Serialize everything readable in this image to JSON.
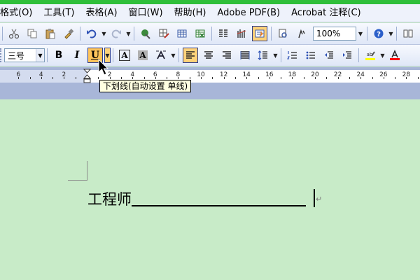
{
  "menu": [
    "格式(O)",
    "工具(T)",
    "表格(A)",
    "窗口(W)",
    "帮助(H)",
    "Adobe PDF(B)",
    "Acrobat 注释(C)"
  ],
  "toolbar1": {
    "zoom": "100%"
  },
  "toolbar2": {
    "font_size": "三号",
    "bold_label": "B",
    "italic_label": "I",
    "underline_label": "U",
    "char_border_label": "A",
    "char_shading_label": "A"
  },
  "ruler": {
    "left_ticks": [
      "6",
      "4",
      "2"
    ],
    "right_ticks": [
      "2",
      "4",
      "6",
      "8",
      "10",
      "12",
      "14",
      "16",
      "18",
      "20",
      "22",
      "24",
      "26",
      "28"
    ]
  },
  "tooltip": "下划线(自动设置 单线)",
  "document": {
    "text": "工程师"
  },
  "colors": {
    "document_bg": "#c8ebc8",
    "highlight": "#ffff00",
    "font_color": "#ff0000",
    "active_button": "#ffd27a"
  },
  "icons": [
    "cut-icon",
    "copy-icon",
    "paste-icon",
    "format-painter-icon",
    "undo-icon",
    "redo-icon",
    "hyperlink-icon",
    "tables-borders-icon",
    "insert-table-icon",
    "insert-excel-icon",
    "columns-icon",
    "drawing-icon",
    "document-map-icon",
    "show-hide-icon",
    "help-icon",
    "read-icon",
    "align-left-icon",
    "center-icon",
    "align-right-icon",
    "justify-icon",
    "line-spacing-icon",
    "numbering-icon",
    "bullets-icon",
    "decrease-indent-icon",
    "increase-indent-icon",
    "highlight-icon",
    "font-color-icon",
    "mouse-pointer-icon"
  ]
}
